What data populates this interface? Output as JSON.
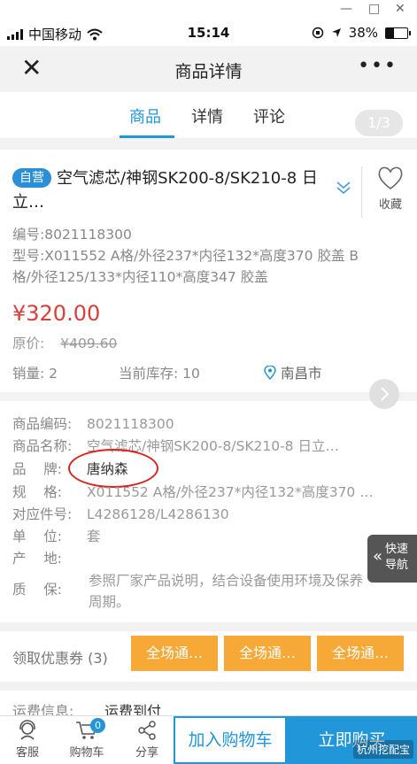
{
  "window_controls": {
    "minimize": "—",
    "maximize": "□",
    "close": "✕"
  },
  "status_bar": {
    "carrier": "中国移动",
    "time": "15:14",
    "battery": "38%",
    "battery_level": 0.38
  },
  "nav": {
    "title": "商品详情",
    "more": "•••"
  },
  "tabs": [
    {
      "label": "商品",
      "active": true
    },
    {
      "label": "详情",
      "active": false
    },
    {
      "label": "评论",
      "active": false
    }
  ],
  "pager": "1/3",
  "product": {
    "badge": "自营",
    "name": "空气滤芯/神钢SK200-8/SK210-8 日立…",
    "favorite_label": "收藏",
    "code_line": "编号:8021118300",
    "model_line": "型号:X011552 A格/外径237*内径132*高度370 胶盖 B格/外径125/133*内径110*高度347 胶盖",
    "price": "¥320.00",
    "original_label": "原价:",
    "original_price": "¥409.60",
    "sales": "销量: 2",
    "stock": "当前库存: 10",
    "location": "南昌市"
  },
  "specs": [
    {
      "key": "商品编码:",
      "value": "8021118300"
    },
    {
      "key": "商品名称:",
      "value": "空气滤芯/神钢SK200-8/SK210-8 日立…"
    },
    {
      "key": "品    牌:",
      "value": "唐纳森"
    },
    {
      "key": "规    格:",
      "value": "X011552 A格/外径237*内径132*高度370 …"
    },
    {
      "key": "对应件号:",
      "value": "L4286128/L4286130"
    },
    {
      "key": "单    位:",
      "value": "套"
    },
    {
      "key": "产    地:",
      "value": ""
    },
    {
      "key": "质    保:",
      "value": "参照厂家产品说明，结合设备使用环境及保养"
    },
    {
      "key": "",
      "value": "周期。"
    }
  ],
  "quick_nav": {
    "line1": "快速",
    "line2": "导航"
  },
  "coupons": {
    "label": "领取优惠券 (3)",
    "items": [
      "全场通…",
      "全场通…",
      "全场通…"
    ]
  },
  "shipping": {
    "label": "运费信息:",
    "value": "运费到付"
  },
  "bottom": {
    "service": "客服",
    "cart": "购物车",
    "cart_count": "0",
    "share": "分享",
    "add_to_cart": "加入购物车",
    "buy_now": "立即购买"
  },
  "watermark": "杭州挖配宝"
}
